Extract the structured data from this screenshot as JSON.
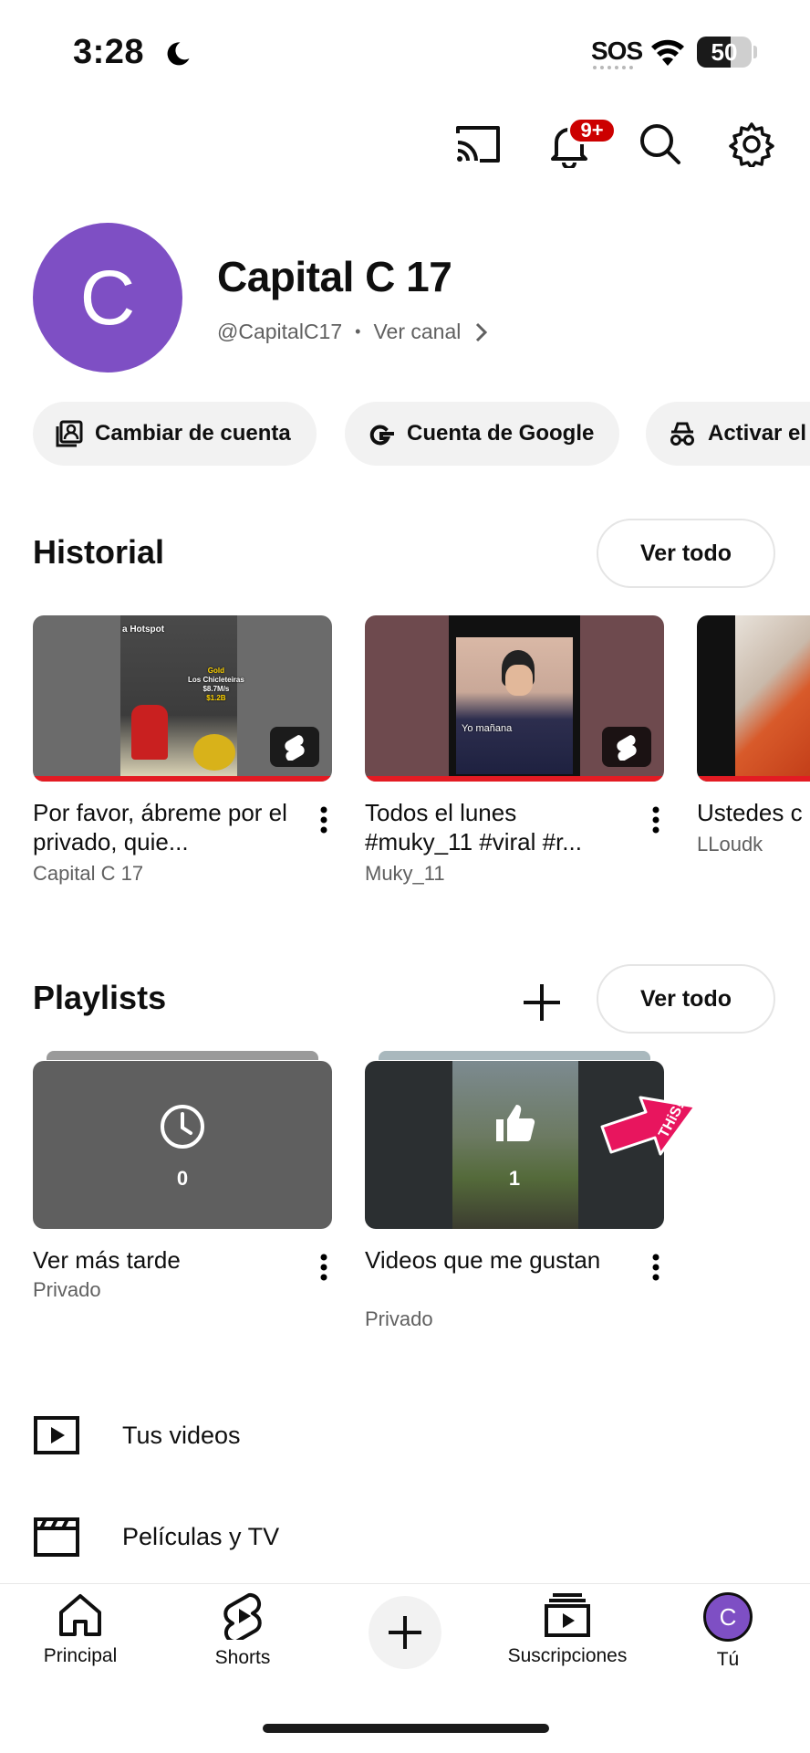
{
  "status_bar": {
    "time": "3:28",
    "carrier": "SOS",
    "battery": "50"
  },
  "header": {
    "notifications_badge": "9+"
  },
  "profile": {
    "avatar_letter": "C",
    "name": "Capital C 17",
    "handle": "@CapitalC17",
    "separator": "•",
    "view_channel": "Ver canal"
  },
  "chips": [
    {
      "label": "Cambiar de cuenta",
      "icon": "switch-account-icon"
    },
    {
      "label": "Cuenta de Google",
      "icon": "google-g-icon"
    },
    {
      "label": "Activar el",
      "icon": "incognito-icon"
    }
  ],
  "history": {
    "title": "Historial",
    "see_all": "Ver todo",
    "items": [
      {
        "title": "Por favor, ábreme por el privado, quie...",
        "channel": "Capital C 17",
        "overlay_lines": [
          "a Hotspot",
          "Gold",
          "Los Chicleteiras",
          "$8.7M/s",
          "$1.2B"
        ]
      },
      {
        "title": "Todos el lunes #muky_11 #viral #r...",
        "channel": "Muky_11",
        "overlay_lines": [
          "Yo mañana"
        ]
      },
      {
        "title": "Ustedes c",
        "channel": "LLoudk"
      }
    ]
  },
  "playlists": {
    "title": "Playlists",
    "see_all": "Ver todo",
    "items": [
      {
        "title": "Ver más tarde",
        "privacy": "Privado",
        "count": "0",
        "icon": "clock-icon"
      },
      {
        "title": "Videos que me gustan",
        "privacy": "Privado",
        "count": "1",
        "icon": "thumbs-up-icon",
        "sticker": "THiS!"
      }
    ]
  },
  "menu": [
    {
      "label": "Tus videos",
      "icon": "play-square-icon"
    },
    {
      "label": "Películas y TV",
      "icon": "clapperboard-icon"
    }
  ],
  "nav": [
    {
      "label": "Principal",
      "icon": "home-icon"
    },
    {
      "label": "Shorts",
      "icon": "shorts-icon"
    },
    {
      "label": "",
      "icon": "plus-icon"
    },
    {
      "label": "Suscripciones",
      "icon": "subscriptions-icon"
    },
    {
      "label": "Tú",
      "icon": "avatar-icon",
      "avatar_letter": "C"
    }
  ],
  "colors": {
    "accent_red": "#cc0000",
    "progress_red": "#e31b23",
    "avatar_purple": "#7e4fc4"
  }
}
